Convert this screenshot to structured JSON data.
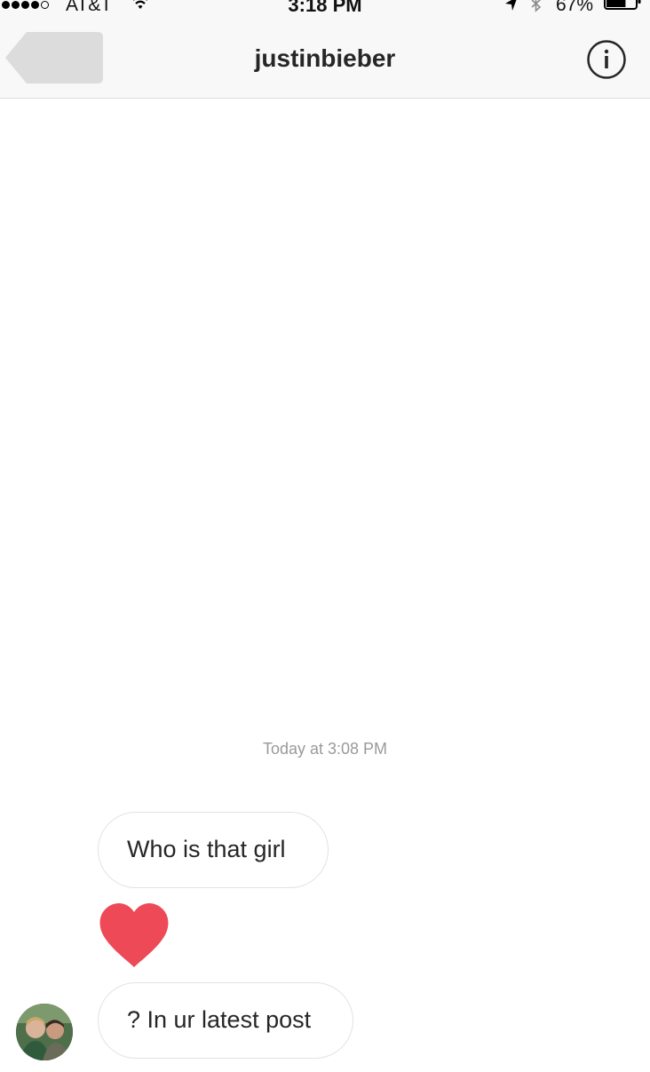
{
  "status_bar": {
    "carrier": "AT&T",
    "time": "3:18 PM",
    "battery_percent": "67%",
    "battery_level": 0.67,
    "signal_strength": 4,
    "signal_total": 5
  },
  "header": {
    "title": "justinbieber",
    "back_icon": "back-arrow-icon",
    "info_icon": "info-circle-icon"
  },
  "thread": {
    "timestamp": "Today at 3:08 PM",
    "messages": [
      {
        "type": "text",
        "text": "Who is that girl"
      },
      {
        "type": "reaction",
        "icon": "heart-icon",
        "color": "#ed4956"
      },
      {
        "type": "text",
        "text": "? In ur latest post"
      }
    ]
  },
  "colors": {
    "bar_background": "#f8f8f8",
    "heart": "#ed4956",
    "timestamp_text": "#9a9a9a",
    "bubble_border": "#e2e2e2"
  }
}
